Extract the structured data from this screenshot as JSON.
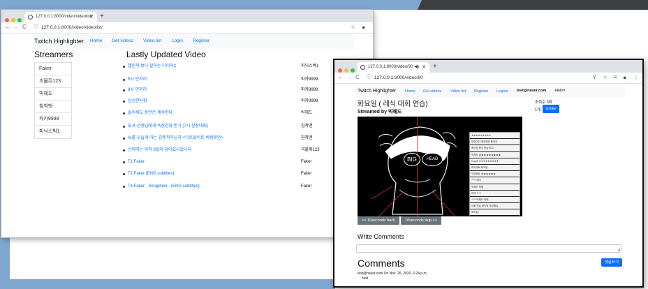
{
  "window1": {
    "tab_title": "127.0.0.1:8000/video/videolist/",
    "url_host": "127.0.0.1",
    "url_rest": ":8000/video/videolist/",
    "navbar": {
      "brand": "Twitch Highlighter",
      "links": [
        "Home",
        "Get videos",
        "Video list",
        "Login",
        "Register"
      ]
    },
    "streamers_heading": "Streamers",
    "streamers": [
      "Faker",
      "괴물쥐123",
      "빅헤드",
      "침착맨",
      "파카9999",
      "피닉스박1"
    ],
    "videos_heading": "Lastly Updated Video",
    "videos": [
      {
        "title": "챌린저 보다 잘하는 다이아2",
        "author": "피닉스박1"
      },
      {
        "title": "5시 언저리",
        "author": "파카9999"
      },
      {
        "title": "8시 언저리",
        "author": "파카9999"
      },
      {
        "title": "심심한사람",
        "author": "파카9999"
      },
      {
        "title": "솔이세도 동반은 계속한다",
        "author": "빅헤드"
      },
      {
        "title": "포셔 선생님에게 속성강좌 받기 (7시 전장대회)",
        "author": "침착맨"
      },
      {
        "title": "AI를 우습게 아는 김풍작가님과 <디트로이트:비컴휴먼>",
        "author": "침착맨"
      },
      {
        "title": "신에게는 아직 8일이 남아있사옵니다",
        "author": "괴물쥐123"
      },
      {
        "title": "T1 Faker",
        "author": "Faker"
      },
      {
        "title": "T1 Faker (ENG subtitles)",
        "author": "Faker"
      },
      {
        "title": "T1 Faker - Seraphine - (ENG subtitles)",
        "author": "Faker"
      }
    ]
  },
  "window2": {
    "tab_title": "127.0.0.1:8000/video/90",
    "url_host": "127.0.0.1",
    "url_rest": ":8000/video/90",
    "navbar": {
      "brand": "Twitch Highlighter",
      "links": [
        "Home",
        "Get videos",
        "Video list",
        "Register",
        "Logout"
      ],
      "user_email": "test@naver.com",
      "greeting": "Hello!"
    },
    "video_title": "화요일 ( 레식 대회 연습)",
    "streamed_by": "Streamed by 빅헤드",
    "views": "조회수 3회",
    "likes": "1개",
    "unlike_label": "Unlike",
    "video_overlay_left": "BIG",
    "video_overlay_right": "HEAD",
    "chat_lines": [
      "★★★★★★★★★",
      "앙앙이다 앙앙해요 좋아요",
      "화이팅 레식 연습 최고",
      "빅헤드 ★★★★★★★★★",
      "hoop9 ★★★★★★★★★",
      "레식대회 화이팅",
      "앙앙해요 ★★★★★★",
      "ㅋㅋ 레식",
      "빅헤드 빅헤",
      "레식 ㅋㅋ",
      "ㅋㅋ 빅헤드 빅헤",
      "대회 연습 화이팅 앙앙해요",
      "화이팅!"
    ],
    "btn_back": "<< 10seconds back",
    "btn_skip": "10seconds skip >>",
    "write_comments_heading": "Write Comments",
    "submit_comment": "댓글쓰기",
    "comments_heading": "Comments",
    "comments": [
      {
        "meta": "test@naver.com On Nov. 26, 2020, 6:24 p.m.",
        "text": "test"
      }
    ]
  }
}
